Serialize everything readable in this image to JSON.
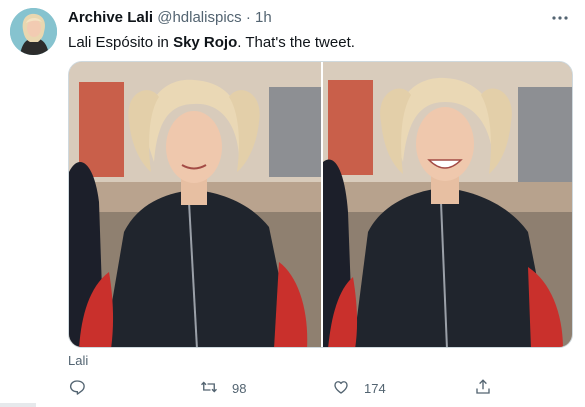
{
  "tweet": {
    "display_name": "Archive Lali",
    "handle": "@hdlalispics",
    "separator": "·",
    "time": "1h",
    "text_before": "Lali Espósito in ",
    "text_bold": "Sky Rojo",
    "text_after": ". That's the tweet.",
    "media_caption": "Lali"
  },
  "actions": {
    "reply_count": "",
    "retweet_count": "98",
    "like_count": "174"
  },
  "icons": {
    "more": "more-horizontal-icon",
    "reply": "reply-icon",
    "retweet": "retweet-icon",
    "like": "heart-icon",
    "share": "share-icon"
  },
  "colors": {
    "text": "#0f1419",
    "secondary": "#536471",
    "border": "#cfd9de"
  }
}
